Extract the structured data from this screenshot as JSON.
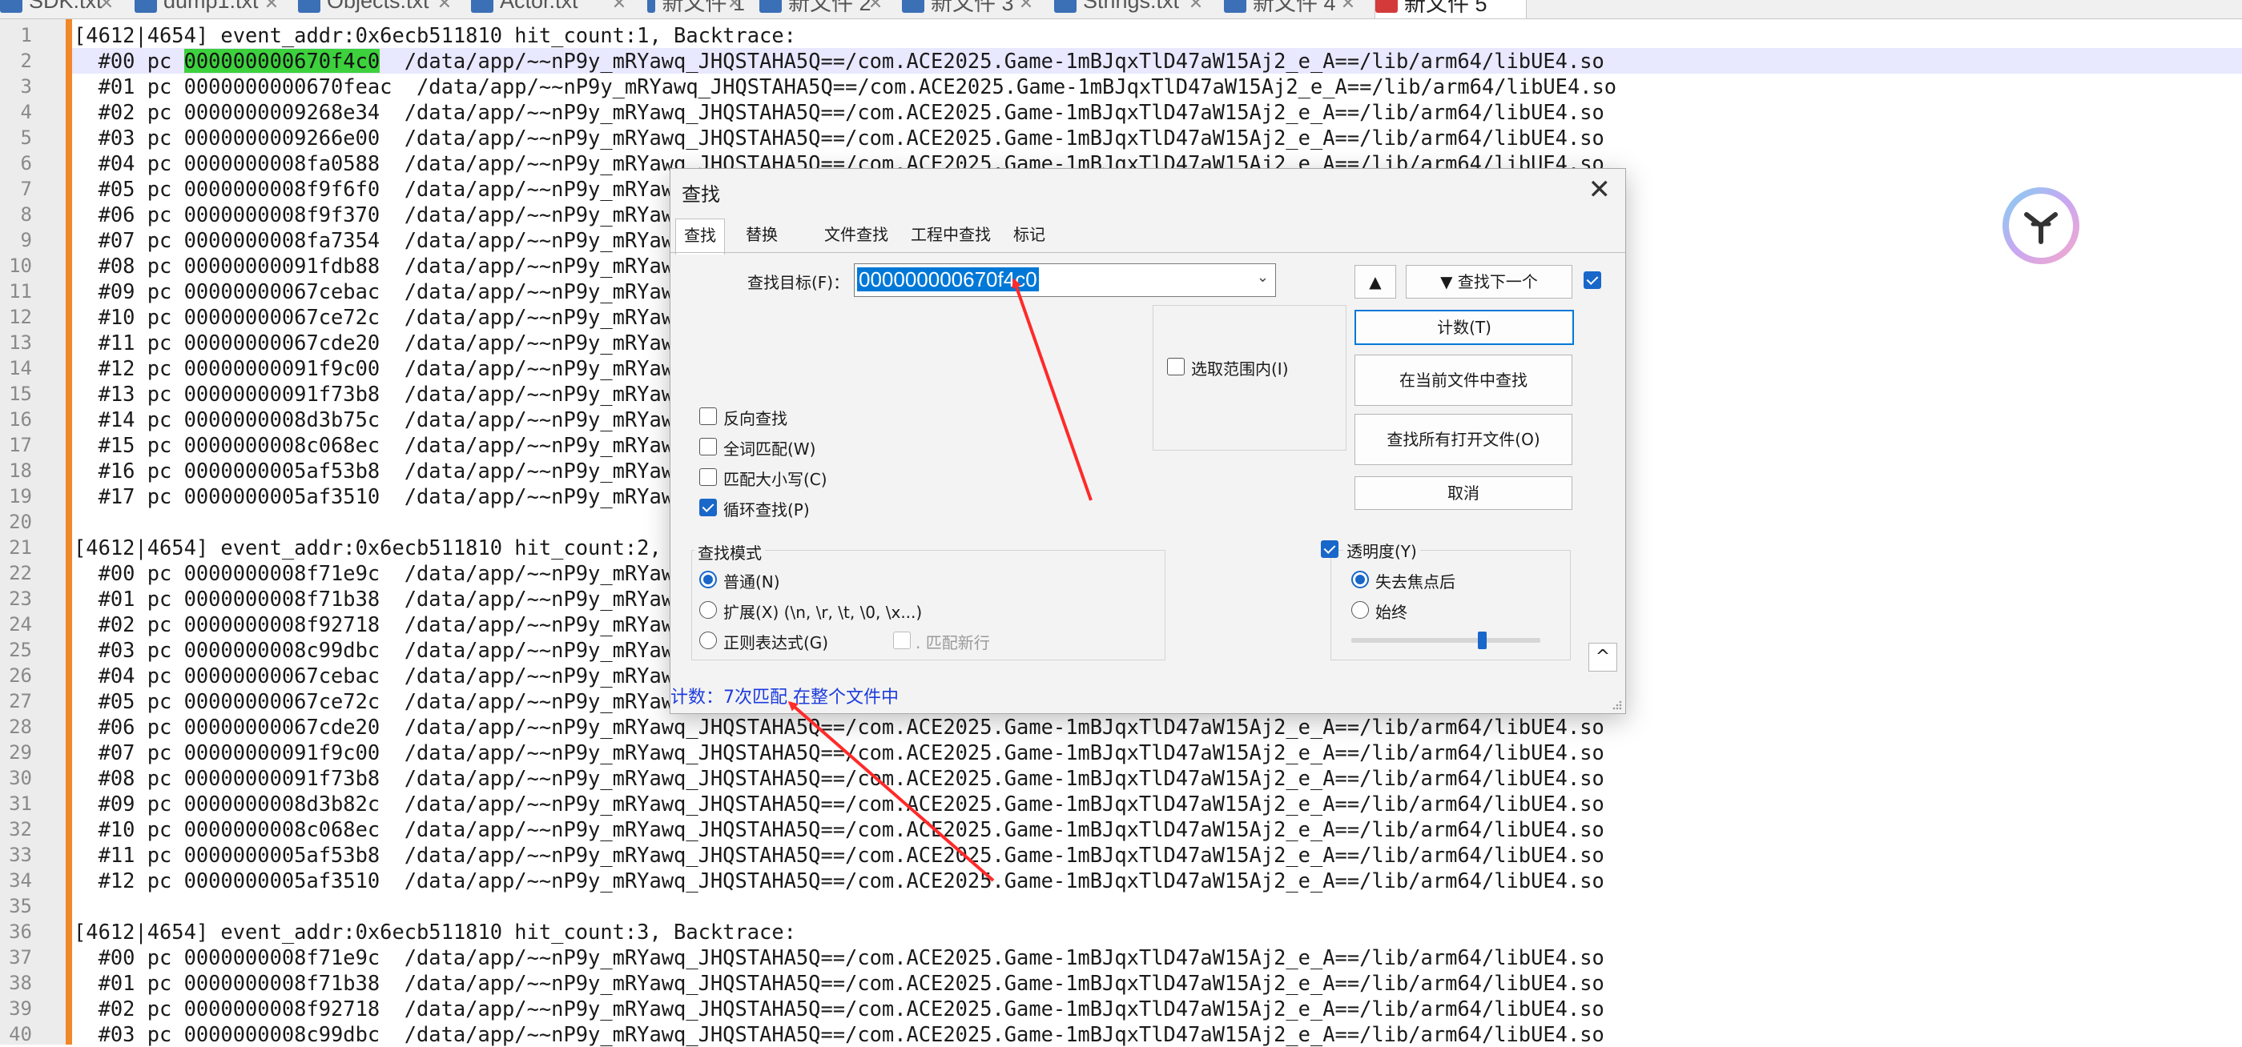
{
  "tabs": [
    {
      "label": "SDK.txt",
      "active": false
    },
    {
      "label": "dump1.txt",
      "active": false
    },
    {
      "label": "Objects.txt",
      "active": false
    },
    {
      "label": "Actor.txt",
      "active": false
    },
    {
      "label": "新文件 1",
      "active": false
    },
    {
      "label": "新文件 2",
      "active": false
    },
    {
      "label": "新文件 3",
      "active": false
    },
    {
      "label": "Strings.txt",
      "active": false
    },
    {
      "label": "新文件 4",
      "active": false
    },
    {
      "label": "新文件 5",
      "active": true
    }
  ],
  "editor": {
    "lines": [
      {
        "n": "1",
        "text": "[4612|4654] event_addr:0x6ecb511810 hit_count:1, Backtrace:"
      },
      {
        "n": "2",
        "pre": "  #00 pc ",
        "hl": "000000000670f4c0",
        "post": "  /data/app/~~nP9y_mRYawq_JHQSTAHA5Q==/com.ACE2025.Game-1mBJqxTlD47aW15Aj2_e_A==/lib/arm64/libUE4.so"
      },
      {
        "n": "3",
        "text": "  #01 pc 0000000000670feac  /data/app/~~nP9y_mRYawq_JHQSTAHA5Q==/com.ACE2025.Game-1mBJqxTlD47aW15Aj2_e_A==/lib/arm64/libUE4.so"
      },
      {
        "n": "4",
        "text": "  #02 pc 0000000009268e34  /data/app/~~nP9y_mRYawq_JHQSTAHA5Q==/com.ACE2025.Game-1mBJqxTlD47aW15Aj2_e_A==/lib/arm64/libUE4.so"
      },
      {
        "n": "5",
        "text": "  #03 pc 0000000009266e00  /data/app/~~nP9y_mRYawq_JHQSTAHA5Q==/com.ACE2025.Game-1mBJqxTlD47aW15Aj2_e_A==/lib/arm64/libUE4.so"
      },
      {
        "n": "6",
        "text": "  #04 pc 0000000008fa0588  /data/app/~~nP9y_mRYawq_JHQSTAHA5Q==/com.ACE2025.Game-1mBJqxTlD47aW15Aj2_e_A==/lib/arm64/libUE4.so"
      },
      {
        "n": "7",
        "text": "  #05 pc 0000000008f9f6f0  /data/app/~~nP9y_mRYawq_JHQSTAHA5Q==/com.ACE2025.Game-1mBJqxTlD47aW15Aj2_e_A==/lib/arm64/libUE4.so"
      },
      {
        "n": "8",
        "text": "  #06 pc 0000000008f9f370  /data/app/~~nP9y_mRYawq_JHQSTAHA5Q==/com.ACE2025.Game-1mBJqxTlD47aW15Aj2_e_A==/lib/arm64/libUE4.so"
      },
      {
        "n": "9",
        "text": "  #07 pc 0000000008fa7354  /data/app/~~nP9y_mRYawq_JHQSTAHA5Q==/com.ACE2025.Game-1mBJqxTlD47aW15Aj2_e_A==/lib/arm64/libUE4.so"
      },
      {
        "n": "10",
        "text": "  #08 pc 00000000091fdb88  /data/app/~~nP9y_mRYawq_JHQSTAHA5Q==/com.ACE2025.Game-1mBJqxTlD47aW15Aj2_e_A==/lib/arm64/libUE4.so"
      },
      {
        "n": "11",
        "text": "  #09 pc 00000000067cebac  /data/app/~~nP9y_mRYawq_JHQSTAHA5Q==/com.ACE2025.Game-1mBJqxTlD47aW15Aj2_e_A==/lib/arm64/libUE4.so"
      },
      {
        "n": "12",
        "text": "  #10 pc 00000000067ce72c  /data/app/~~nP9y_mRYawq_JHQSTAHA5Q==/com.ACE2025.Game-1mBJqxTlD47aW15Aj2_e_A==/lib/arm64/libUE4.so"
      },
      {
        "n": "13",
        "text": "  #11 pc 00000000067cde20  /data/app/~~nP9y_mRYawq_JHQSTAHA5Q==/com.ACE2025.Game-1mBJqxTlD47aW15Aj2_e_A==/lib/arm64/libUE4.so"
      },
      {
        "n": "14",
        "text": "  #12 pc 00000000091f9c00  /data/app/~~nP9y_mRYawq_JHQSTAHA5Q==/com.ACE2025.Game-1mBJqxTlD47aW15Aj2_e_A==/lib/arm64/libUE4.so"
      },
      {
        "n": "15",
        "text": "  #13 pc 00000000091f73b8  /data/app/~~nP9y_mRYawq_JHQSTAHA5Q==/com.ACE2025.Game-1mBJqxTlD47aW15Aj2_e_A==/lib/arm64/libUE4.so"
      },
      {
        "n": "16",
        "text": "  #14 pc 0000000008d3b75c  /data/app/~~nP9y_mRYawq_JHQSTAHA5Q==/com.ACE2025.Game-1mBJqxTlD47aW15Aj2_e_A==/lib/arm64/libUE4.so"
      },
      {
        "n": "17",
        "text": "  #15 pc 0000000008c068ec  /data/app/~~nP9y_mRYawq_JHQSTAHA5Q==/com.ACE2025.Game-1mBJqxTlD47aW15Aj2_e_A==/lib/arm64/libUE4.so"
      },
      {
        "n": "18",
        "text": "  #16 pc 0000000005af53b8  /data/app/~~nP9y_mRYawq_JHQSTAHA5Q==/com.ACE2025.Game-1mBJqxTlD47aW15Aj2_e_A==/lib/arm64/libUE4.so"
      },
      {
        "n": "19",
        "text": "  #17 pc 0000000005af3510  /data/app/~~nP9y_mRYawq_JHQSTAHA5Q==/com.ACE2025.Game-1mBJqxTlD47aW15Aj2_e_A==/lib/arm64/libUE4.so"
      },
      {
        "n": "20",
        "text": ""
      },
      {
        "n": "21",
        "text": "[4612|4654] event_addr:0x6ecb511810 hit_count:2, Backtrace:"
      },
      {
        "n": "22",
        "text": "  #00 pc 0000000008f71e9c  /data/app/~~nP9y_mRYawq_JHQSTAHA5Q==/com.ACE2025.Game-1mBJqxTlD47aW15Aj2_e_A==/lib/arm64/libUE4.so"
      },
      {
        "n": "23",
        "text": "  #01 pc 0000000008f71b38  /data/app/~~nP9y_mRYawq_JHQSTAHA5Q==/com.ACE2025.Game-1mBJqxTlD47aW15Aj2_e_A==/lib/arm64/libUE4.so"
      },
      {
        "n": "24",
        "text": "  #02 pc 0000000008f92718  /data/app/~~nP9y_mRYawq_JHQSTAHA5Q==/com.ACE2025.Game-1mBJqxTlD47aW15Aj2_e_A==/lib/arm64/libUE4.so"
      },
      {
        "n": "25",
        "text": "  #03 pc 0000000008c99dbc  /data/app/~~nP9y_mRYawq_JHQSTAHA5Q==/com.ACE2025.Game-1mBJqxTlD47aW15Aj2_e_A==/lib/arm64/libUE4.so"
      },
      {
        "n": "26",
        "text": "  #04 pc 00000000067cebac  /data/app/~~nP9y_mRYawq_JHQSTAHA5Q==/com.ACE2025.Game-1mBJqxTlD47aW15Aj2_e_A==/lib/arm64/libUE4.so"
      },
      {
        "n": "27",
        "text": "  #05 pc 00000000067ce72c  /data/app/~~nP9y_mRYawq_JHQSTAHA5Q==/com.ACE2025.Game-1mBJqxTlD47aW15Aj2_e_A==/lib/arm64/libUE4.so"
      },
      {
        "n": "28",
        "text": "  #06 pc 00000000067cde20  /data/app/~~nP9y_mRYawq_JHQSTAHA5Q==/com.ACE2025.Game-1mBJqxTlD47aW15Aj2_e_A==/lib/arm64/libUE4.so"
      },
      {
        "n": "29",
        "text": "  #07 pc 00000000091f9c00  /data/app/~~nP9y_mRYawq_JHQSTAHA5Q==/com.ACE2025.Game-1mBJqxTlD47aW15Aj2_e_A==/lib/arm64/libUE4.so"
      },
      {
        "n": "30",
        "text": "  #08 pc 00000000091f73b8  /data/app/~~nP9y_mRYawq_JHQSTAHA5Q==/com.ACE2025.Game-1mBJqxTlD47aW15Aj2_e_A==/lib/arm64/libUE4.so"
      },
      {
        "n": "31",
        "text": "  #09 pc 0000000008d3b82c  /data/app/~~nP9y_mRYawq_JHQSTAHA5Q==/com.ACE2025.Game-1mBJqxTlD47aW15Aj2_e_A==/lib/arm64/libUE4.so"
      },
      {
        "n": "32",
        "text": "  #10 pc 0000000008c068ec  /data/app/~~nP9y_mRYawq_JHQSTAHA5Q==/com.ACE2025.Game-1mBJqxTlD47aW15Aj2_e_A==/lib/arm64/libUE4.so"
      },
      {
        "n": "33",
        "text": "  #11 pc 0000000005af53b8  /data/app/~~nP9y_mRYawq_JHQSTAHA5Q==/com.ACE2025.Game-1mBJqxTlD47aW15Aj2_e_A==/lib/arm64/libUE4.so"
      },
      {
        "n": "34",
        "text": "  #12 pc 0000000005af3510  /data/app/~~nP9y_mRYawq_JHQSTAHA5Q==/com.ACE2025.Game-1mBJqxTlD47aW15Aj2_e_A==/lib/arm64/libUE4.so"
      },
      {
        "n": "35",
        "text": ""
      },
      {
        "n": "36",
        "text": "[4612|4654] event_addr:0x6ecb511810 hit_count:3, Backtrace:"
      },
      {
        "n": "37",
        "text": "  #00 pc 0000000008f71e9c  /data/app/~~nP9y_mRYawq_JHQSTAHA5Q==/com.ACE2025.Game-1mBJqxTlD47aW15Aj2_e_A==/lib/arm64/libUE4.so"
      },
      {
        "n": "38",
        "text": "  #01 pc 0000000008f71b38  /data/app/~~nP9y_mRYawq_JHQSTAHA5Q==/com.ACE2025.Game-1mBJqxTlD47aW15Aj2_e_A==/lib/arm64/libUE4.so"
      },
      {
        "n": "39",
        "text": "  #02 pc 0000000008f92718  /data/app/~~nP9y_mRYawq_JHQSTAHA5Q==/com.ACE2025.Game-1mBJqxTlD47aW15Aj2_e_A==/lib/arm64/libUE4.so"
      },
      {
        "n": "40",
        "text": "  #03 pc 0000000008c99dbc  /data/app/~~nP9y_mRYawq_JHQSTAHA5Q==/com.ACE2025.Game-1mBJqxTlD47aW15Aj2_e_A==/lib/arm64/libUE4.so"
      }
    ]
  },
  "dialog": {
    "title": "查找",
    "tabs": [
      "查找",
      "替换",
      "文件查找",
      "工程中查找",
      "标记"
    ],
    "find_label": "查找目标(F)：",
    "find_value": "000000000670f4c0",
    "up_label": "▲",
    "find_next_label": "▼ 查找下一个",
    "count_label": "计数(T)",
    "find_in_current_label": "在当前文件中查找",
    "find_all_open_label": "查找所有打开文件(O)",
    "cancel_label": "取消",
    "in_selection_label": "选取范围内(I)",
    "options": [
      {
        "label": "反向查找",
        "checked": false
      },
      {
        "label": "全词匹配(W)",
        "checked": false
      },
      {
        "label": "匹配大小写(C)",
        "checked": false
      },
      {
        "label": "循环查找(P)",
        "checked": true
      }
    ],
    "search_mode_title": "查找模式",
    "search_modes": [
      {
        "label": "普通(N)",
        "selected": true
      },
      {
        "label": "扩展(X) (\\n, \\r, \\t, \\0, \\x...)",
        "selected": false
      },
      {
        "label": "正则表达式(G)",
        "selected": false
      }
    ],
    "match_newline_label": ". 匹配新行",
    "transparency_label": "透明度(Y)",
    "transparency_checked": true,
    "transparency_modes": [
      {
        "label": "失去焦点后",
        "selected": true
      },
      {
        "label": "始终",
        "selected": false
      }
    ],
    "transparency_level": 0.7,
    "collapse_label": "^",
    "status_text": "计数：7次匹配 在整个文件中"
  },
  "colors": {
    "highlight": "#3dd13d",
    "accent": "#1867c9",
    "status": "#1d3bdc",
    "annotation_arrow": "#ff2a2a"
  }
}
